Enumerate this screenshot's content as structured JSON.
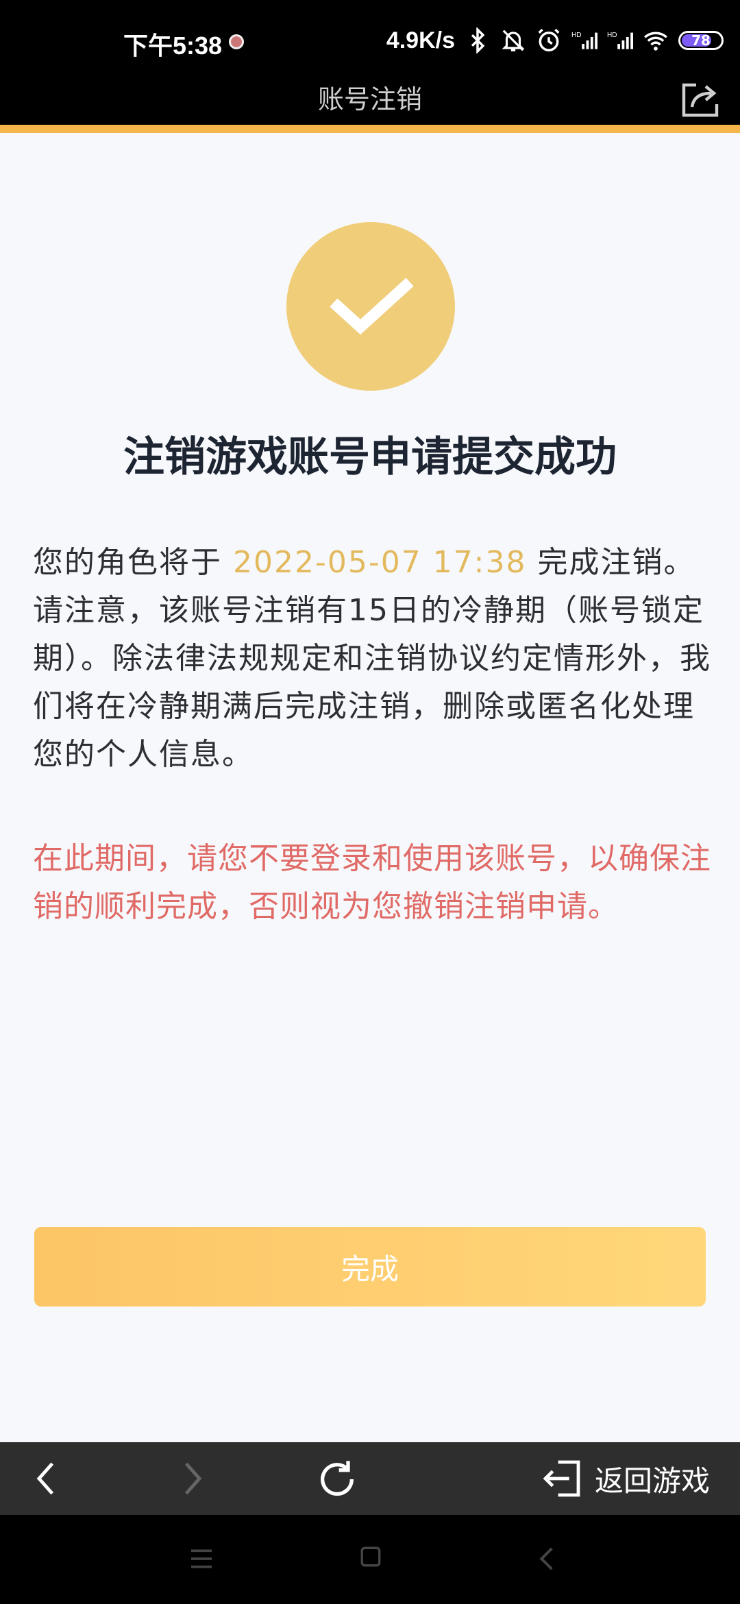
{
  "status_bar": {
    "time": "下午5:38",
    "net_speed": "4.9K/s",
    "battery": "78",
    "icons": [
      "bluetooth-icon",
      "mute-icon",
      "alarm-icon",
      "signal-hd-icon",
      "signal-hd-icon",
      "wifi-icon",
      "battery-icon"
    ]
  },
  "title_bar": {
    "title": "账号注销",
    "share_icon": "share-icon"
  },
  "main": {
    "success_icon": "check-icon",
    "headline": "注销游戏账号申请提交成功",
    "body_before_date": "您的角色将于 ",
    "body_date": "2022-05-07 17:38",
    "body_after_date": " 完成注销。请注意，该账号注销有15日的冷静期（账号锁定期）。除法律法规规定和注销协议约定情形外，我们将在冷静期满后完成注销，删除或匿名化处理您的个人信息。",
    "warning": "在此期间，请您不要登录和使用该账号，以确保注销的顺利完成，否则视为您撤销注销申请。",
    "done_label": "完成"
  },
  "browser_bar": {
    "return_label": "返回游戏"
  },
  "colors": {
    "accent": "#f4b64a",
    "circle": "#f0cd78",
    "date": "#e3b95d",
    "warning": "#e06a66"
  }
}
